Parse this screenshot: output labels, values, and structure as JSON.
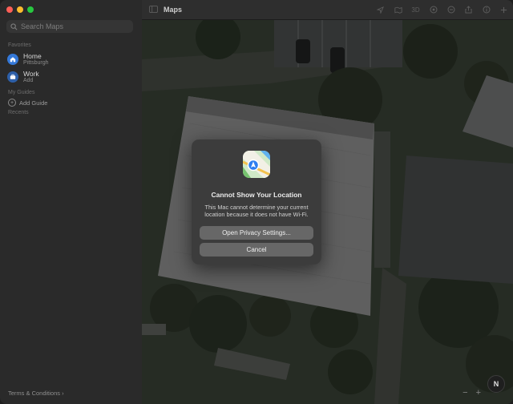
{
  "window": {
    "title": "Maps"
  },
  "sidebar": {
    "search_placeholder": "Search Maps",
    "favorites_label": "Favorites",
    "favorites": [
      {
        "title": "Home",
        "subtitle": "Pittsburgh",
        "icon": "house-icon"
      },
      {
        "title": "Work",
        "subtitle": "Add",
        "icon": "briefcase-icon"
      }
    ],
    "guides_label": "My Guides",
    "add_guide_label": "Add Guide",
    "recents_label": "Recents",
    "terms_label": "Terms & Conditions"
  },
  "toolbar": {
    "title": "Maps",
    "icons": [
      "location-arrow-icon",
      "map-mode-icon",
      "3d-toggle",
      "look-around-icon",
      "zoom-icon",
      "share-icon",
      "info-icon",
      "add-icon"
    ],
    "three_d_label": "3D"
  },
  "map": {
    "compass_label": "N",
    "zoom_out": "−",
    "zoom_in": "+"
  },
  "dialog": {
    "title": "Cannot Show Your Location",
    "message": "This Mac cannot determine your current location because it does not have Wi-Fi.",
    "primary_button": "Open Privacy Settings...",
    "cancel_button": "Cancel"
  },
  "colors": {
    "accent": "#3478d8",
    "close": "#fe5f57",
    "minimize": "#febc2e",
    "maximize": "#28c840"
  }
}
